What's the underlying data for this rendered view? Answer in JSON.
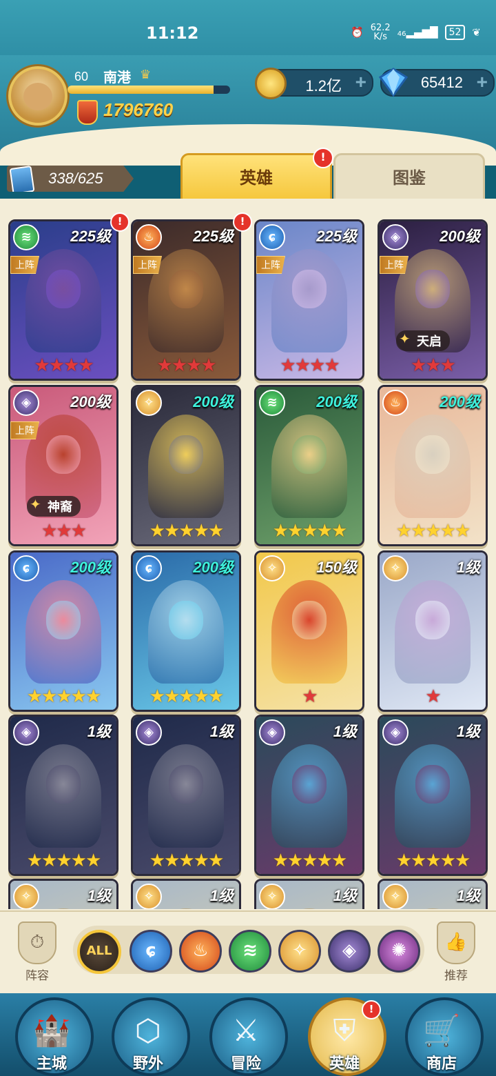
{
  "status_bar": {
    "time": "11:12",
    "net_speed": "62.2",
    "net_speed_unit": "K/s",
    "signal": "46",
    "battery": "52"
  },
  "player": {
    "level": "60",
    "name": "南港",
    "power": "1796760",
    "xp_fraction": 0.9
  },
  "resources": {
    "gold": "1.2亿",
    "gems": "65412",
    "plus": "+"
  },
  "tabs": {
    "hero_count": "338/625",
    "heroes": "英雄",
    "gallery": "图鉴",
    "alert": "!"
  },
  "deployed_label": "上阵",
  "cards": [
    {
      "level": "225级",
      "faction": "wind",
      "deployed": true,
      "stars": 4,
      "star_color": "red",
      "alert": true,
      "title": ""
    },
    {
      "level": "225级",
      "faction": "fire",
      "deployed": true,
      "stars": 4,
      "star_color": "red",
      "alert": true,
      "title": ""
    },
    {
      "level": "225级",
      "faction": "water",
      "deployed": true,
      "stars": 4,
      "star_color": "red",
      "alert": false,
      "title": ""
    },
    {
      "level": "200级",
      "faction": "dark",
      "deployed": true,
      "stars": 3,
      "star_color": "red",
      "alert": false,
      "title": "天启"
    },
    {
      "level": "200级",
      "faction": "dark",
      "deployed": true,
      "stars": 3,
      "star_color": "red",
      "alert": false,
      "title": "神裔"
    },
    {
      "level": "200级",
      "faction": "light",
      "deployed": false,
      "stars": 5,
      "star_color": "gold",
      "alert": false,
      "title": "",
      "teal": true
    },
    {
      "level": "200级",
      "faction": "wind",
      "deployed": false,
      "stars": 5,
      "star_color": "gold",
      "alert": false,
      "title": "",
      "teal": true
    },
    {
      "level": "200级",
      "faction": "fire",
      "deployed": false,
      "stars": 5,
      "star_color": "gold",
      "alert": false,
      "title": "",
      "teal": true
    },
    {
      "level": "200级",
      "faction": "water",
      "deployed": false,
      "stars": 5,
      "star_color": "gold",
      "alert": false,
      "title": "",
      "teal": true
    },
    {
      "level": "200级",
      "faction": "water",
      "deployed": false,
      "stars": 5,
      "star_color": "gold",
      "alert": false,
      "title": "",
      "teal": true
    },
    {
      "level": "150级",
      "faction": "light",
      "deployed": false,
      "stars": 1,
      "star_color": "red",
      "alert": false,
      "title": ""
    },
    {
      "level": "1级",
      "faction": "light",
      "deployed": false,
      "stars": 1,
      "star_color": "red",
      "alert": false,
      "title": ""
    },
    {
      "level": "1级",
      "faction": "dark",
      "deployed": false,
      "stars": 5,
      "star_color": "gold",
      "alert": false,
      "title": ""
    },
    {
      "level": "1级",
      "faction": "dark",
      "deployed": false,
      "stars": 5,
      "star_color": "gold",
      "alert": false,
      "title": ""
    },
    {
      "level": "1级",
      "faction": "dark",
      "deployed": false,
      "stars": 5,
      "star_color": "gold",
      "alert": false,
      "title": ""
    },
    {
      "level": "1级",
      "faction": "dark",
      "deployed": false,
      "stars": 5,
      "star_color": "gold",
      "alert": false,
      "title": ""
    },
    {
      "level": "1级",
      "faction": "light",
      "deployed": false,
      "stars": 0,
      "star_color": "gold",
      "alert": false,
      "title": ""
    },
    {
      "level": "1级",
      "faction": "light",
      "deployed": false,
      "stars": 0,
      "star_color": "gold",
      "alert": false,
      "title": ""
    },
    {
      "level": "1级",
      "faction": "light",
      "deployed": false,
      "stars": 0,
      "star_color": "gold",
      "alert": false,
      "title": ""
    },
    {
      "level": "1级",
      "faction": "light",
      "deployed": false,
      "stars": 0,
      "star_color": "gold",
      "alert": false,
      "title": ""
    }
  ],
  "filters": {
    "lineup_label": "阵容",
    "recommend_label": "推荐",
    "all_label": "ALL",
    "factions": [
      "water",
      "fire",
      "wind",
      "light",
      "dark",
      "chaos"
    ]
  },
  "nav": {
    "items": [
      "主城",
      "野外",
      "冒险",
      "英雄",
      "商店"
    ],
    "active": "英雄"
  },
  "colors": {
    "teal_level": "#3ef2dd",
    "star_red": "#e13a3a",
    "star_gold": "#ffd22e",
    "alert_red": "#e5332a"
  }
}
